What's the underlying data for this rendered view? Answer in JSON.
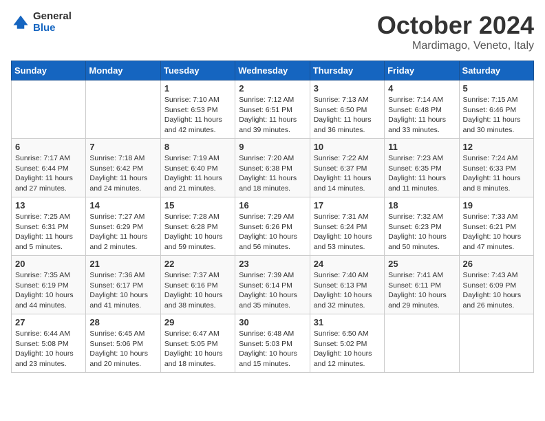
{
  "header": {
    "logo_general": "General",
    "logo_blue": "Blue",
    "month_title": "October 2024",
    "location": "Mardimago, Veneto, Italy"
  },
  "days_of_week": [
    "Sunday",
    "Monday",
    "Tuesday",
    "Wednesday",
    "Thursday",
    "Friday",
    "Saturday"
  ],
  "weeks": [
    [
      {
        "day": "",
        "info": ""
      },
      {
        "day": "",
        "info": ""
      },
      {
        "day": "1",
        "info": "Sunrise: 7:10 AM\nSunset: 6:53 PM\nDaylight: 11 hours and 42 minutes."
      },
      {
        "day": "2",
        "info": "Sunrise: 7:12 AM\nSunset: 6:51 PM\nDaylight: 11 hours and 39 minutes."
      },
      {
        "day": "3",
        "info": "Sunrise: 7:13 AM\nSunset: 6:50 PM\nDaylight: 11 hours and 36 minutes."
      },
      {
        "day": "4",
        "info": "Sunrise: 7:14 AM\nSunset: 6:48 PM\nDaylight: 11 hours and 33 minutes."
      },
      {
        "day": "5",
        "info": "Sunrise: 7:15 AM\nSunset: 6:46 PM\nDaylight: 11 hours and 30 minutes."
      }
    ],
    [
      {
        "day": "6",
        "info": "Sunrise: 7:17 AM\nSunset: 6:44 PM\nDaylight: 11 hours and 27 minutes."
      },
      {
        "day": "7",
        "info": "Sunrise: 7:18 AM\nSunset: 6:42 PM\nDaylight: 11 hours and 24 minutes."
      },
      {
        "day": "8",
        "info": "Sunrise: 7:19 AM\nSunset: 6:40 PM\nDaylight: 11 hours and 21 minutes."
      },
      {
        "day": "9",
        "info": "Sunrise: 7:20 AM\nSunset: 6:38 PM\nDaylight: 11 hours and 18 minutes."
      },
      {
        "day": "10",
        "info": "Sunrise: 7:22 AM\nSunset: 6:37 PM\nDaylight: 11 hours and 14 minutes."
      },
      {
        "day": "11",
        "info": "Sunrise: 7:23 AM\nSunset: 6:35 PM\nDaylight: 11 hours and 11 minutes."
      },
      {
        "day": "12",
        "info": "Sunrise: 7:24 AM\nSunset: 6:33 PM\nDaylight: 11 hours and 8 minutes."
      }
    ],
    [
      {
        "day": "13",
        "info": "Sunrise: 7:25 AM\nSunset: 6:31 PM\nDaylight: 11 hours and 5 minutes."
      },
      {
        "day": "14",
        "info": "Sunrise: 7:27 AM\nSunset: 6:29 PM\nDaylight: 11 hours and 2 minutes."
      },
      {
        "day": "15",
        "info": "Sunrise: 7:28 AM\nSunset: 6:28 PM\nDaylight: 10 hours and 59 minutes."
      },
      {
        "day": "16",
        "info": "Sunrise: 7:29 AM\nSunset: 6:26 PM\nDaylight: 10 hours and 56 minutes."
      },
      {
        "day": "17",
        "info": "Sunrise: 7:31 AM\nSunset: 6:24 PM\nDaylight: 10 hours and 53 minutes."
      },
      {
        "day": "18",
        "info": "Sunrise: 7:32 AM\nSunset: 6:23 PM\nDaylight: 10 hours and 50 minutes."
      },
      {
        "day": "19",
        "info": "Sunrise: 7:33 AM\nSunset: 6:21 PM\nDaylight: 10 hours and 47 minutes."
      }
    ],
    [
      {
        "day": "20",
        "info": "Sunrise: 7:35 AM\nSunset: 6:19 PM\nDaylight: 10 hours and 44 minutes."
      },
      {
        "day": "21",
        "info": "Sunrise: 7:36 AM\nSunset: 6:17 PM\nDaylight: 10 hours and 41 minutes."
      },
      {
        "day": "22",
        "info": "Sunrise: 7:37 AM\nSunset: 6:16 PM\nDaylight: 10 hours and 38 minutes."
      },
      {
        "day": "23",
        "info": "Sunrise: 7:39 AM\nSunset: 6:14 PM\nDaylight: 10 hours and 35 minutes."
      },
      {
        "day": "24",
        "info": "Sunrise: 7:40 AM\nSunset: 6:13 PM\nDaylight: 10 hours and 32 minutes."
      },
      {
        "day": "25",
        "info": "Sunrise: 7:41 AM\nSunset: 6:11 PM\nDaylight: 10 hours and 29 minutes."
      },
      {
        "day": "26",
        "info": "Sunrise: 7:43 AM\nSunset: 6:09 PM\nDaylight: 10 hours and 26 minutes."
      }
    ],
    [
      {
        "day": "27",
        "info": "Sunrise: 6:44 AM\nSunset: 5:08 PM\nDaylight: 10 hours and 23 minutes."
      },
      {
        "day": "28",
        "info": "Sunrise: 6:45 AM\nSunset: 5:06 PM\nDaylight: 10 hours and 20 minutes."
      },
      {
        "day": "29",
        "info": "Sunrise: 6:47 AM\nSunset: 5:05 PM\nDaylight: 10 hours and 18 minutes."
      },
      {
        "day": "30",
        "info": "Sunrise: 6:48 AM\nSunset: 5:03 PM\nDaylight: 10 hours and 15 minutes."
      },
      {
        "day": "31",
        "info": "Sunrise: 6:50 AM\nSunset: 5:02 PM\nDaylight: 10 hours and 12 minutes."
      },
      {
        "day": "",
        "info": ""
      },
      {
        "day": "",
        "info": ""
      }
    ]
  ]
}
